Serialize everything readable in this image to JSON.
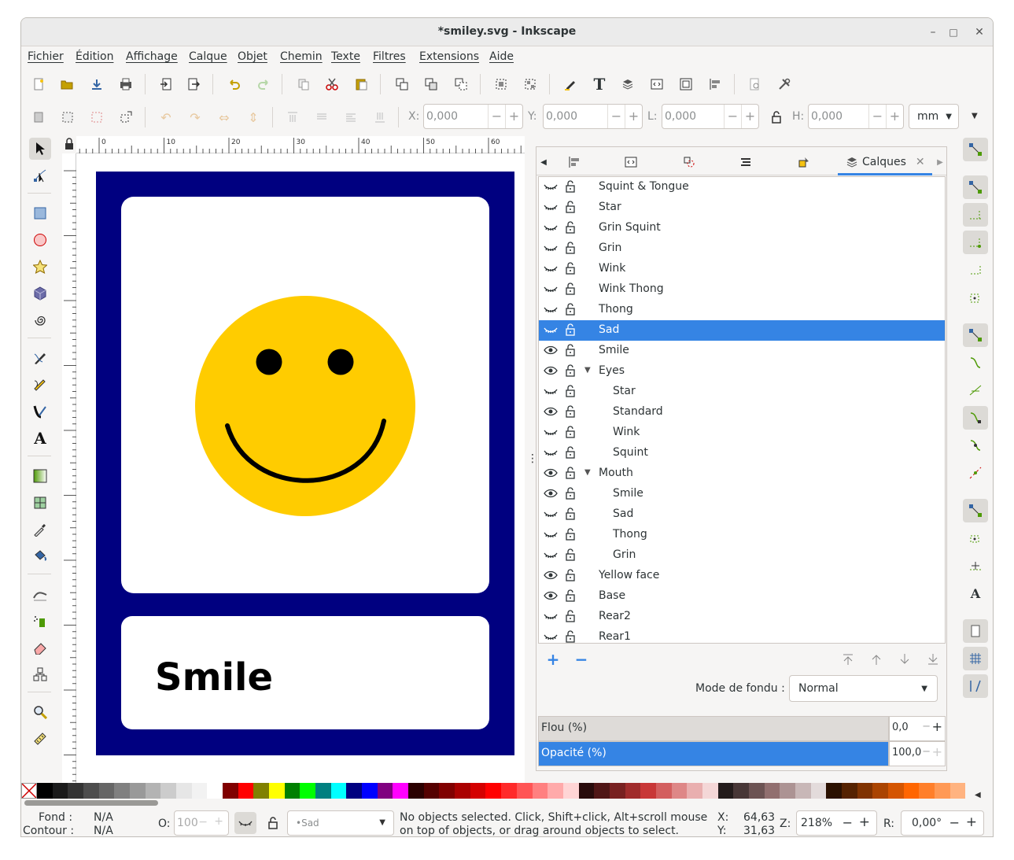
{
  "window": {
    "title": "*smiley.svg - Inkscape",
    "minimize": "–",
    "maximize": "□",
    "close": "✕"
  },
  "menu": [
    "Fichier",
    "Édition",
    "Affichage",
    "Calque",
    "Objet",
    "Chemin",
    "Texte",
    "Filtres",
    "Extensions",
    "Aide"
  ],
  "toolbar2": {
    "x_label": "X:",
    "x_value": "0,000",
    "y_label": "Y:",
    "y_value": "0,000",
    "w_label": "L:",
    "w_value": "0,000",
    "h_label": "H:",
    "h_value": "0,000",
    "unit": "mm"
  },
  "ruler": {
    "ticks": [
      "0",
      "10",
      "20",
      "30",
      "40",
      "50",
      "60"
    ]
  },
  "canvas": {
    "card_text": "Smile",
    "colors": {
      "border": "#000080",
      "face": "#ffcc00",
      "features": "#000000"
    }
  },
  "panel": {
    "active_tab": "Calques",
    "layers": [
      {
        "label": "Squint & Tongue",
        "indent": 0,
        "visible": false
      },
      {
        "label": "Star",
        "indent": 0,
        "visible": false
      },
      {
        "label": "Grin Squint",
        "indent": 0,
        "visible": false
      },
      {
        "label": "Grin",
        "indent": 0,
        "visible": false
      },
      {
        "label": "Wink",
        "indent": 0,
        "visible": false
      },
      {
        "label": "Wink Thong",
        "indent": 0,
        "visible": false
      },
      {
        "label": "Thong",
        "indent": 0,
        "visible": false
      },
      {
        "label": "Sad",
        "indent": 0,
        "visible": false,
        "selected": true
      },
      {
        "label": "Smile",
        "indent": 0,
        "visible": true
      },
      {
        "label": "Eyes",
        "indent": 0,
        "visible": true,
        "expander": true
      },
      {
        "label": "Star",
        "indent": 1,
        "visible": false
      },
      {
        "label": "Standard",
        "indent": 1,
        "visible": true
      },
      {
        "label": "Wink",
        "indent": 1,
        "visible": false
      },
      {
        "label": "Squint",
        "indent": 1,
        "visible": false
      },
      {
        "label": "Mouth",
        "indent": 0,
        "visible": true,
        "expander": true
      },
      {
        "label": "Smile",
        "indent": 1,
        "visible": true
      },
      {
        "label": "Sad",
        "indent": 1,
        "visible": false
      },
      {
        "label": "Thong",
        "indent": 1,
        "visible": false
      },
      {
        "label": "Grin",
        "indent": 1,
        "visible": false
      },
      {
        "label": "Yellow face",
        "indent": 0,
        "visible": true
      },
      {
        "label": "Base",
        "indent": 0,
        "visible": true
      },
      {
        "label": "Rear2",
        "indent": 0,
        "visible": false
      },
      {
        "label": "Rear1",
        "indent": 0,
        "visible": false
      }
    ],
    "blend_label": "Mode de fondu :",
    "blend_value": "Normal",
    "blur_label": "Flou (%)",
    "blur_value": "0,0",
    "opacity_label": "Opacité (%)",
    "opacity_value": "100,0",
    "opacity_fraction": 1.0,
    "blur_fraction": 0.0
  },
  "status": {
    "fill_label": "Fond :",
    "fill_value": "N/A",
    "stroke_label": "Contour :",
    "stroke_value": "N/A",
    "o_label": "O:",
    "o_value": "100",
    "layer_value": "•Sad",
    "message": "No objects selected. Click, Shift+click, Alt+scroll mouse on top of objects, or drag around objects to select.",
    "x_label": "X:",
    "x_value": "64,63",
    "y_label": "Y:",
    "y_value": "31,63",
    "z_label": "Z:",
    "zoom": "218%",
    "r_label": "R:",
    "rotation": "0,00°"
  },
  "palette": [
    "#000000",
    "#1a1a1a",
    "#333333",
    "#4d4d4d",
    "#666666",
    "#808080",
    "#999999",
    "#b3b3b3",
    "#cccccc",
    "#e6e6e6",
    "#f2f2f2",
    "#ffffff",
    "#800000",
    "#ff0000",
    "#808000",
    "#ffff00",
    "#008000",
    "#00ff00",
    "#008080",
    "#00ffff",
    "#000080",
    "#0000ff",
    "#800080",
    "#ff00ff",
    "#2b0000",
    "#550000",
    "#800000",
    "#aa0000",
    "#d40000",
    "#ff0000",
    "#ff2a2a",
    "#ff5555",
    "#ff8080",
    "#ffaaaa",
    "#ffd5d5",
    "#280b0b",
    "#501616",
    "#782121",
    "#a02c2c",
    "#c83737",
    "#d35f5f",
    "#de8787",
    "#e9afaf",
    "#f4d7d7",
    "#241c1c",
    "#483737",
    "#6c5353",
    "#916f6f",
    "#ac9393",
    "#c8b7b7",
    "#e3dbdb",
    "#2b1100",
    "#552200",
    "#803300",
    "#aa4400",
    "#d45500",
    "#ff6600",
    "#ff7f2a",
    "#ff9955",
    "#ffb380"
  ]
}
